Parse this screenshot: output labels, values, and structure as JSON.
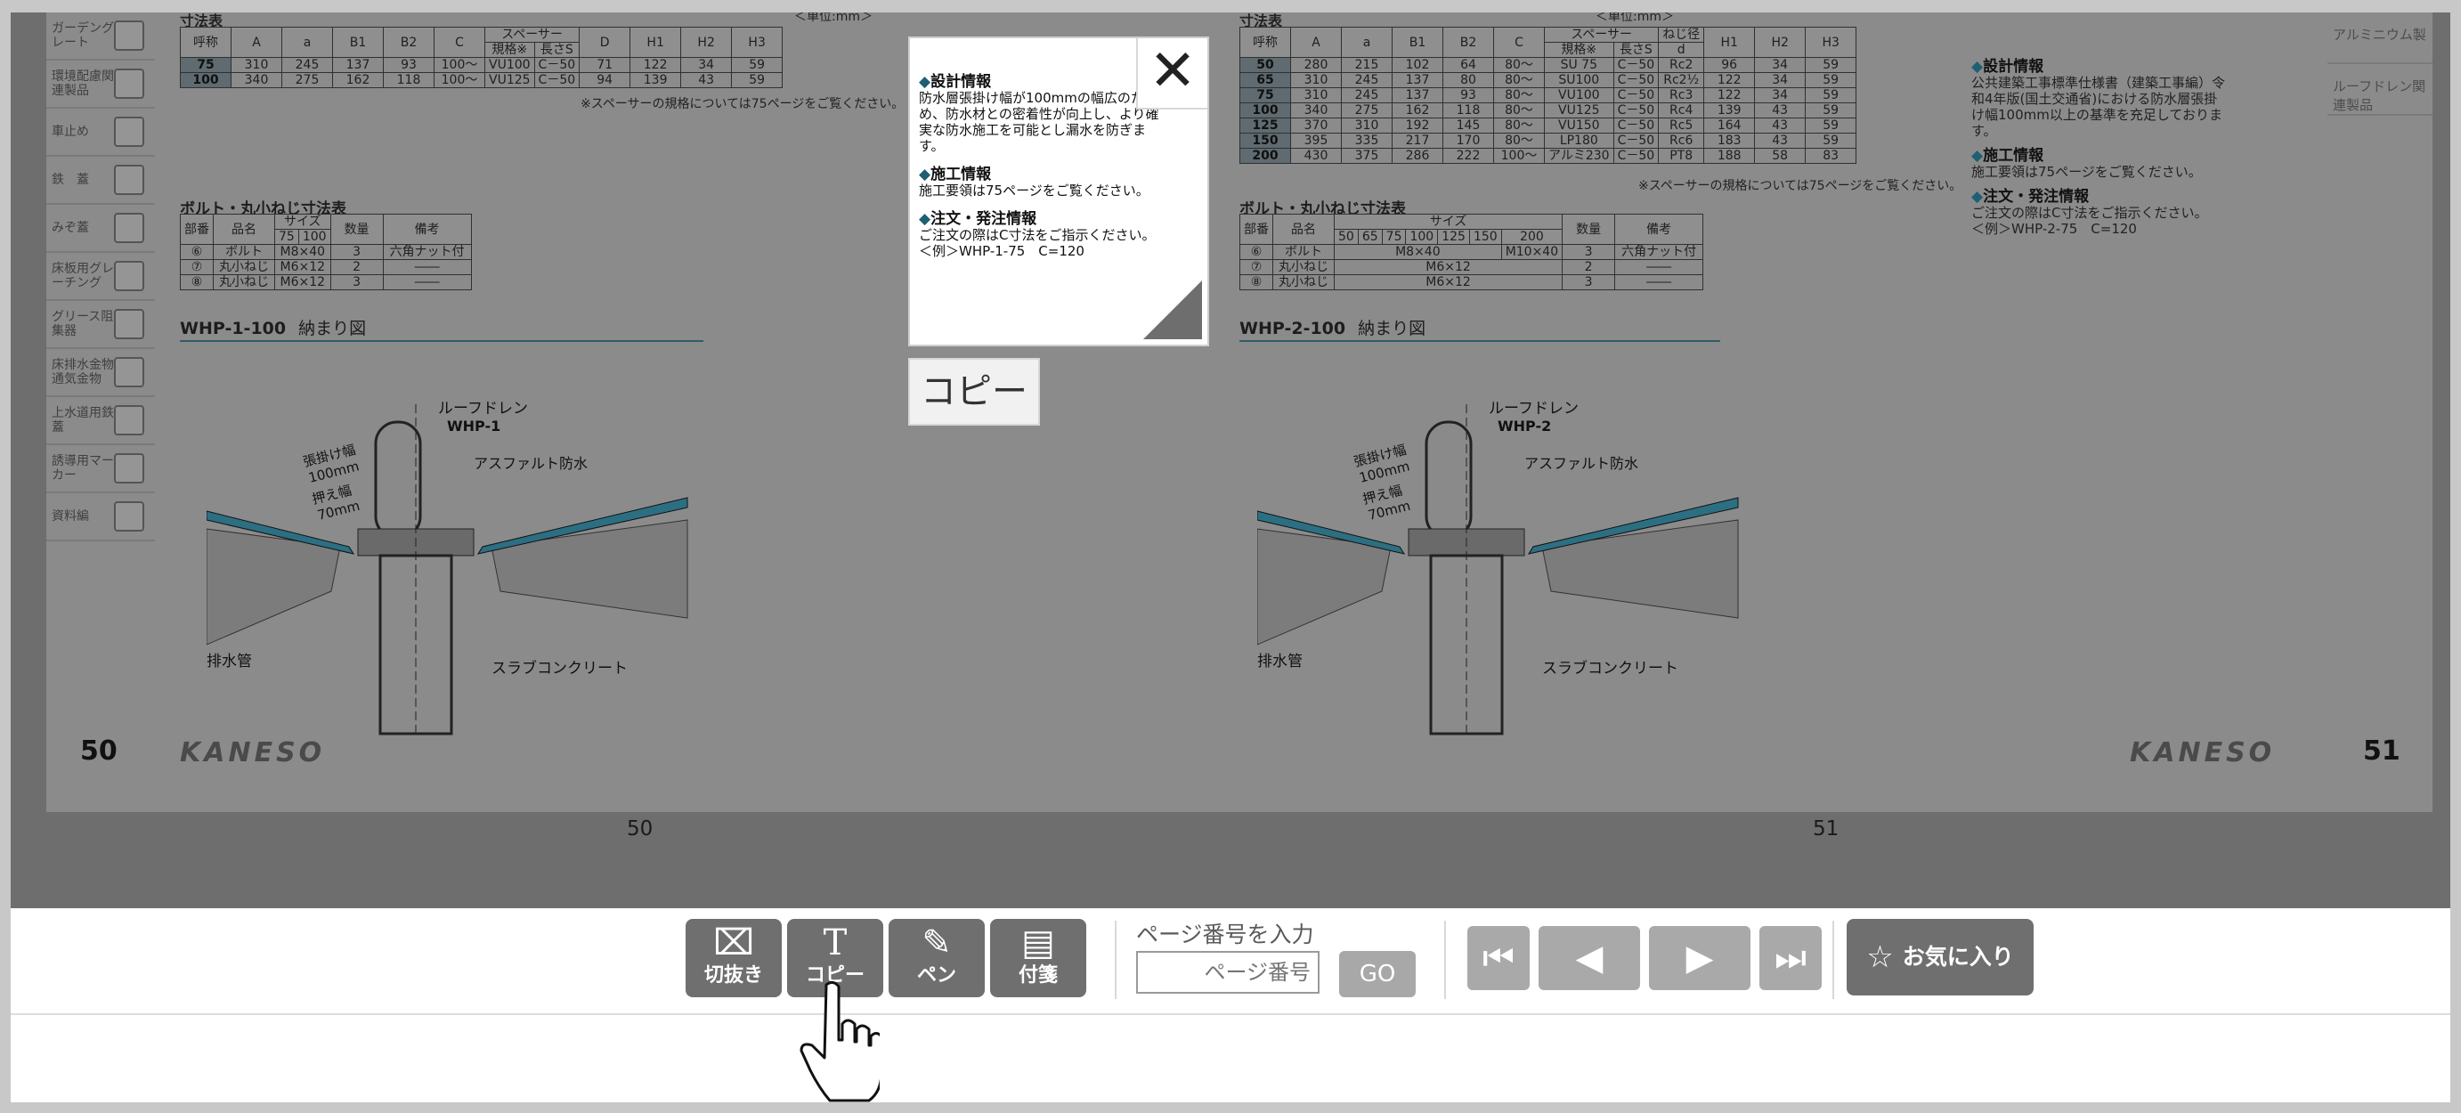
{
  "popup": {
    "close_glyph": "✕",
    "design_heading": "設計情報",
    "design_text": "防水層張掛け幅が100mmの幅広のため、防水材との密着性が向上し、より確実な防水施工を可能とし漏水を防ぎます。",
    "construction_heading": "施工情報",
    "construction_text": "施工要領は75ページをご覧ください。",
    "order_heading": "注文・発注情報",
    "order_text": "ご注文の際はC寸法をご指示ください。",
    "order_example": "＜例＞WHP-1-75　C=120"
  },
  "copy_button": "コピー",
  "left_page": {
    "sidebar": [
      "ガーデングレート",
      "環境配慮関連製品",
      "車止め",
      "鉄　蓋",
      "みぞ蓋",
      "床板用グレーチング",
      "グリース阻集器",
      "床排水金物通気金物",
      "上水道用鉄　蓋",
      "誘導用マーカー",
      "資料編"
    ],
    "table_title": "寸法表",
    "table_unit": "＜単位:mm＞",
    "table_headers": [
      "呼称",
      "A",
      "a",
      "B1",
      "B2",
      "C",
      "規格※",
      "長さS",
      "D",
      "H1",
      "H2",
      "H3"
    ],
    "spacer_header": "スペーサー",
    "rows": [
      [
        "75",
        "310",
        "245",
        "137",
        "93",
        "100～",
        "VU100",
        "C－50",
        "71",
        "122",
        "34",
        "59"
      ],
      [
        "100",
        "340",
        "275",
        "162",
        "118",
        "100～",
        "VU125",
        "C－50",
        "94",
        "139",
        "43",
        "59"
      ]
    ],
    "table_note": "※スペーサーの規格については75ページをご覧ください。",
    "bolt_title": "ボルト・丸小ねじ寸法表",
    "bolt_headers": [
      "部番",
      "品名",
      "75",
      "100",
      "数量",
      "備考"
    ],
    "bolt_size_header": "サイズ",
    "bolt_rows": [
      [
        "⑥",
        "ボルト",
        "M8×40",
        "3",
        "六角ナット付"
      ],
      [
        "⑦",
        "丸小ねじ",
        "M6×12",
        "2",
        "――"
      ],
      [
        "⑧",
        "丸小ねじ",
        "M6×12",
        "3",
        "――"
      ]
    ],
    "figure_title": "WHP-1-100",
    "figure_subtitle": "納まり図",
    "figure_labels": {
      "drain": "ルーフドレン",
      "model": "WHP-1",
      "width": "張掛け幅",
      "width_val": "100mm",
      "press": "押え幅",
      "press_val": "70mm",
      "asphalt": "アスファルト防水",
      "pipe": "排水管",
      "slab": "スラブコンクリート"
    },
    "page_number": "50",
    "brand": "KANESO",
    "below_number": "50"
  },
  "right_page": {
    "sidebar": [
      "アルミニウム製",
      "ルーフドレン関連製品"
    ],
    "table_title": "寸法表",
    "table_unit": "＜単位:mm＞",
    "table_headers": [
      "呼称",
      "A",
      "a",
      "B1",
      "B2",
      "C",
      "規格※",
      "長さS",
      "d",
      "H1",
      "H2",
      "H3"
    ],
    "spacer_header": "スペーサー",
    "thread_header": "ねじ径",
    "rows": [
      [
        "50",
        "280",
        "215",
        "102",
        "64",
        "80～",
        "SU 75",
        "C－50",
        "Rc2",
        "96",
        "34",
        "59"
      ],
      [
        "65",
        "310",
        "245",
        "137",
        "80",
        "80～",
        "SU100",
        "C－50",
        "Rc2½",
        "122",
        "34",
        "59"
      ],
      [
        "75",
        "310",
        "245",
        "137",
        "93",
        "80～",
        "VU100",
        "C－50",
        "Rc3",
        "122",
        "34",
        "59"
      ],
      [
        "100",
        "340",
        "275",
        "162",
        "118",
        "80～",
        "VU125",
        "C－50",
        "Rc4",
        "139",
        "43",
        "59"
      ],
      [
        "125",
        "370",
        "310",
        "192",
        "145",
        "80～",
        "VU150",
        "C－50",
        "Rc5",
        "164",
        "43",
        "59"
      ],
      [
        "150",
        "395",
        "335",
        "217",
        "170",
        "80～",
        "LP180",
        "C－50",
        "Rc6",
        "183",
        "43",
        "59"
      ],
      [
        "200",
        "430",
        "375",
        "286",
        "222",
        "100～",
        "アルミ230",
        "C－50",
        "PT8",
        "188",
        "58",
        "83"
      ]
    ],
    "table_note": "※スペーサーの規格については75ページをご覧ください。",
    "info": {
      "design_heading": "設計情報",
      "design_text": "公共建築工事標準仕様書（建築工事編）令和4年版(国土交通省)における防水層張掛け幅100mm以上の基準を充足しております。",
      "construction_heading": "施工情報",
      "construction_text": "施工要領は75ページをご覧ください。",
      "order_heading": "注文・発注情報",
      "order_text": "ご注文の際はC寸法をご指示ください。",
      "order_example": "＜例＞WHP-2-75　C=120"
    },
    "bolt_title": "ボルト・丸小ねじ寸法表",
    "bolt_headers": [
      "部番",
      "品名",
      "50",
      "65",
      "75",
      "100",
      "125",
      "150",
      "200",
      "数量",
      "備考"
    ],
    "bolt_size_header": "サイズ",
    "bolt_rows": [
      [
        "⑥",
        "ボルト",
        "M8×40",
        "M10×40",
        "3",
        "六角ナット付"
      ],
      [
        "⑦",
        "丸小ねじ",
        "M6×12",
        "",
        "2",
        "――"
      ],
      [
        "⑧",
        "丸小ねじ",
        "M6×12",
        "",
        "3",
        "――"
      ]
    ],
    "figure_title": "WHP-2-100",
    "figure_subtitle": "納まり図",
    "figure_labels": {
      "drain": "ルーフドレン",
      "model": "WHP-2",
      "width": "張掛け幅",
      "width_val": "100mm",
      "press": "押え幅",
      "press_val": "70mm",
      "asphalt": "アスファルト防水",
      "pipe": "排水管",
      "slab": "スラブコンクリート"
    },
    "page_number": "51",
    "brand": "KANESO",
    "below_number": "51"
  },
  "toolbar": {
    "crop_label": "切抜き",
    "copy_label": "コピー",
    "pen_label": "ペン",
    "sticky_label": "付箋",
    "page_input_label": "ページ番号を入力",
    "page_input_placeholder": "ページ番号",
    "go_label": "GO",
    "favorite_label": "お気に入り"
  },
  "icons": {
    "crop": "crop-icon",
    "copy": "text-icon",
    "pen": "pen-icon",
    "sticky": "note-icon",
    "first": "first-page-icon",
    "prev": "prev-page-icon",
    "next": "next-page-icon",
    "last": "last-page-icon",
    "favorite": "star-icon",
    "close": "close-icon",
    "cursor": "hand-pointer-icon"
  },
  "colors": {
    "viewer_bg": "#6e6e6e",
    "toolbar_button": "#6f6f6f",
    "nav_button": "#a9a9a9",
    "accent": "#1e5f74"
  }
}
